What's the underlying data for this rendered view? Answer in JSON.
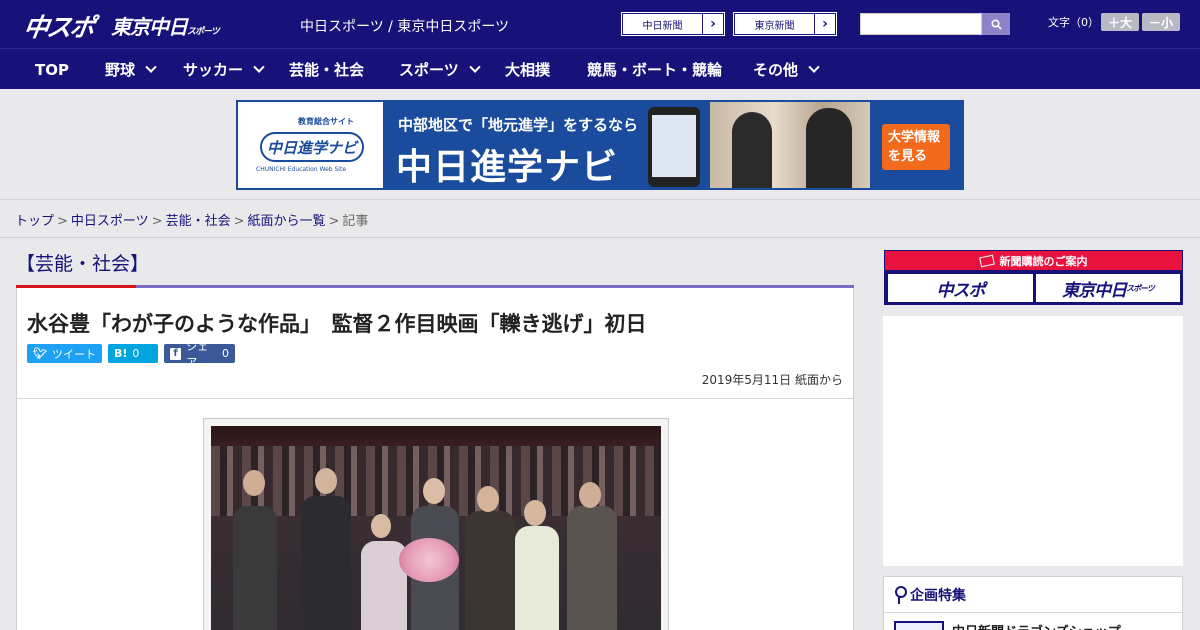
{
  "header": {
    "logo_main": "中スポ",
    "logo_tokyo": "東京中日",
    "logo_tokyo_sub": "スポーツ",
    "site_name": "中日スポーツ / 東京中日スポーツ",
    "newspaper_links": [
      {
        "label": "中日新聞"
      },
      {
        "label": "東京新聞"
      }
    ],
    "search": {
      "value": "",
      "placeholder": ""
    },
    "font_size": {
      "label": "文字（0）",
      "increase": "＋大",
      "decrease": "－小"
    }
  },
  "nav": {
    "items": [
      {
        "label": "TOP",
        "dropdown": false
      },
      {
        "label": "野球",
        "dropdown": true
      },
      {
        "label": "サッカー",
        "dropdown": true
      },
      {
        "label": "芸能・社会",
        "dropdown": false
      },
      {
        "label": "スポーツ",
        "dropdown": true
      },
      {
        "label": "大相撲",
        "dropdown": false
      },
      {
        "label": "競馬・ボート・競輪",
        "dropdown": false
      },
      {
        "label": "その他",
        "dropdown": true
      }
    ]
  },
  "banner": {
    "logo_caption": "教育総合サイト",
    "logo_text": "中日進学ナビ",
    "logo_sub": "CHUNICHI Education Web Site",
    "tagline": "中部地区で「地元進学」をするなら",
    "title": "中日進学ナビ",
    "cta": "大学情報を見る"
  },
  "breadcrumb": {
    "items": [
      "トップ",
      "中日スポーツ",
      "芸能・社会",
      "紙面から一覧"
    ],
    "current": "記事",
    "separator": ">"
  },
  "article": {
    "category": "【芸能・社会】",
    "headline": "水谷豊「わが子のような作品」　監督２作目映画「轢き逃げ」初日",
    "share": {
      "tweet_label": "ツイート",
      "hatena_label": "B!",
      "hatena_count": "0",
      "facebook_label": "シェア",
      "facebook_count": "0"
    },
    "date": "2019年5月11日 紙面から"
  },
  "sidebar": {
    "subscribe_title": "新聞購読のご案内",
    "subscribe_chuspo": "中スポ",
    "subscribe_tokyo": "東京中日",
    "subscribe_tokyo_sub": "スポーツ",
    "feature_title": "企画特集",
    "feature_item": "中日新聞ドラゴンズショップ"
  },
  "colors": {
    "brand_navy": "#17127a",
    "accent_purple": "#7a6cc2",
    "accent_red": "#d9141a",
    "twitter_blue": "#1da1f2",
    "hatena_blue": "#00a4de",
    "facebook_blue": "#3b5998"
  }
}
